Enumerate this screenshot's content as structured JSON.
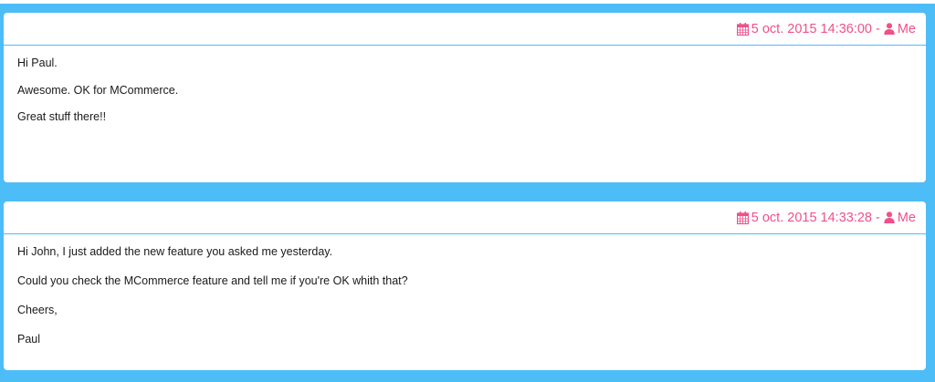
{
  "colors": {
    "background": "#4dbdf7",
    "accent": "#f0508a",
    "text": "#1a1a1a"
  },
  "messages": [
    {
      "date": "5 oct. 2015 14:36:00",
      "separator": "-",
      "author": "Me",
      "date_icon": "calendar-icon",
      "author_icon": "user-icon",
      "lines": [
        "Hi Paul.",
        "Awesome. OK for MCommerce.",
        "Great stuff there!!"
      ]
    },
    {
      "date": "5 oct. 2015 14:33:28",
      "separator": "-",
      "author": "Me",
      "date_icon": "calendar-icon",
      "author_icon": "user-icon",
      "lines": [
        "Hi John, I just added the new feature you asked me yesterday.",
        "Could you check the MCommerce feature and tell me if you're OK whith that?",
        "Cheers,",
        "Paul"
      ]
    }
  ]
}
